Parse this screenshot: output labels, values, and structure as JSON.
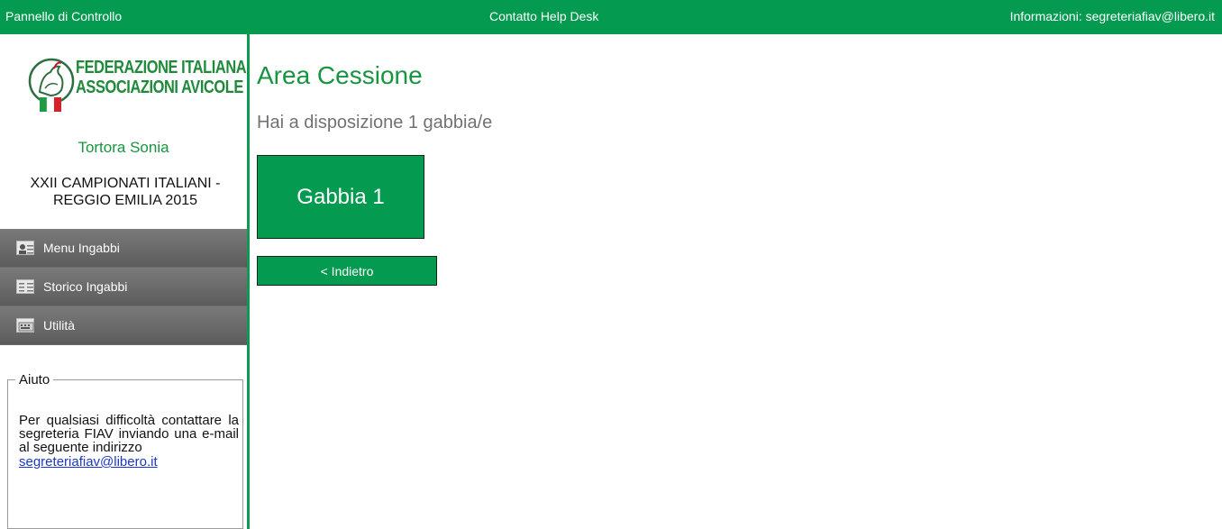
{
  "topbar": {
    "control_panel": "Pannello di Controllo",
    "help_desk": "Contatto Help Desk",
    "info": "Informazioni: segreteriafiav@libero.it"
  },
  "logo": {
    "line1": "FEDERAZIONE ITALIANA",
    "line2": "ASSOCIAZIONI AVICOLE"
  },
  "user": {
    "name": "Tortora Sonia"
  },
  "event": {
    "title": "XXII CAMPIONATI ITALIANI - REGGIO EMILIA 2015"
  },
  "menu": {
    "items": [
      {
        "label": "Menu Ingabbi",
        "icon": "contact-card-icon"
      },
      {
        "label": "Storico Ingabbi",
        "icon": "list-icon"
      },
      {
        "label": "Utilità",
        "icon": "tools-icon"
      }
    ]
  },
  "help": {
    "legend": "Aiuto",
    "text": "Per qualsiasi difficoltà contattare la segreteria FIAV inviando una e-mail al seguente indirizzo",
    "email": "segreteriafiav@libero.it"
  },
  "main": {
    "title": "Area Cessione",
    "subtitle": "Hai a disposizione 1 gabbia/e",
    "cage_button": "Gabbia 1",
    "back_button": "< Indietro"
  },
  "colors": {
    "brand_green": "#049a4f",
    "title_green": "#17943f",
    "menu_gray": "#6b6b6b",
    "link_blue": "#1b38c8"
  }
}
